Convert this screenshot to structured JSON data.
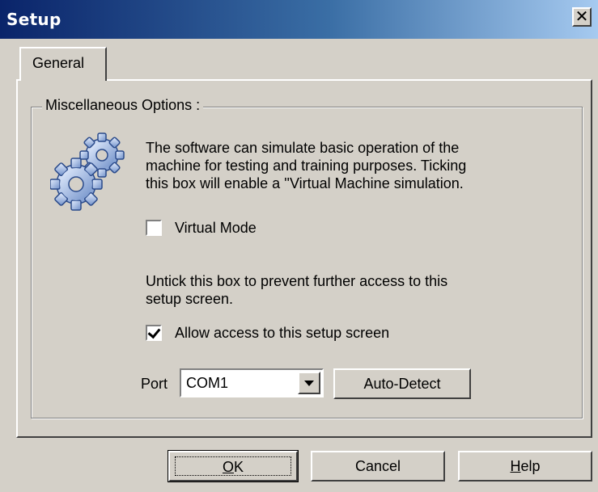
{
  "window": {
    "title": "Setup",
    "close_glyph": "✕"
  },
  "tabs": [
    {
      "label": "General"
    }
  ],
  "group": {
    "label": "Miscellaneous Options :",
    "icon": "gears-icon",
    "description_lines": [
      "The software can simulate basic operation of the",
      "machine for testing and training purposes. Ticking",
      "this box will enable a ''Virtual Machine simulation."
    ],
    "virtual_mode": {
      "label": "Virtual Mode",
      "checked": false
    },
    "access_note_lines": [
      "Untick this box to prevent further access to this",
      "setup screen."
    ],
    "allow_access": {
      "label": "Allow access to this setup screen",
      "checked": true
    },
    "port": {
      "label": "Port",
      "value": "COM1"
    },
    "auto_detect_label": "Auto-Detect"
  },
  "buttons": {
    "ok": {
      "accel": "O",
      "rest": "K"
    },
    "cancel": "Cancel",
    "help": {
      "accel": "H",
      "rest": "elp"
    }
  }
}
